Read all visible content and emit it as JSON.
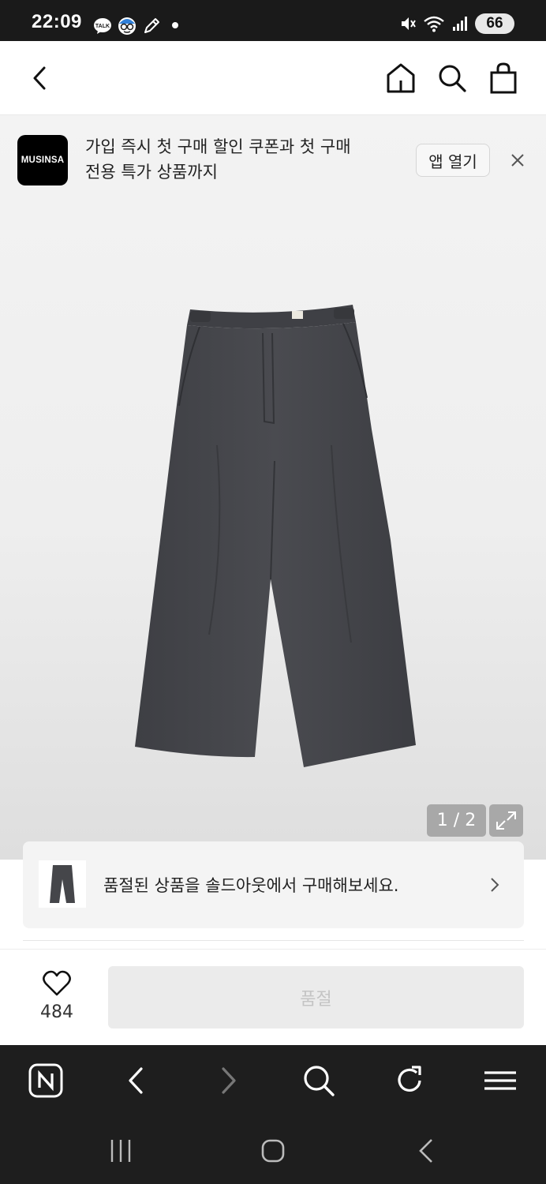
{
  "status_bar": {
    "time": "22:09",
    "battery": "66",
    "notification_icons": [
      "talk-icon",
      "cartoon-face-icon",
      "pen-icon"
    ]
  },
  "top_nav": {
    "icons": [
      "back-icon",
      "home-icon",
      "search-icon",
      "shopping-bag-icon"
    ]
  },
  "app_banner": {
    "logo_text": "MUSINSA",
    "message_line1": "가입 즉시 첫 구매 할인 쿠폰과 첫 구매",
    "message_line2": "전용 특가 상품까지",
    "open_app_label": "앱 열기"
  },
  "product_gallery": {
    "counter": "1 / 2",
    "product_color": "#45464a"
  },
  "soldout_card": {
    "text": "품절된 상품을 솔드아웃에서 구매해보세요."
  },
  "action_bar": {
    "like_count": "484",
    "soldout_label": "품절"
  },
  "browser_toolbar": {
    "icons": [
      "naver-icon",
      "back-icon",
      "forward-icon",
      "search-icon",
      "refresh-icon",
      "menu-icon"
    ]
  },
  "system_nav": {
    "icons": [
      "recent-apps-icon",
      "home-icon",
      "back-icon"
    ]
  }
}
